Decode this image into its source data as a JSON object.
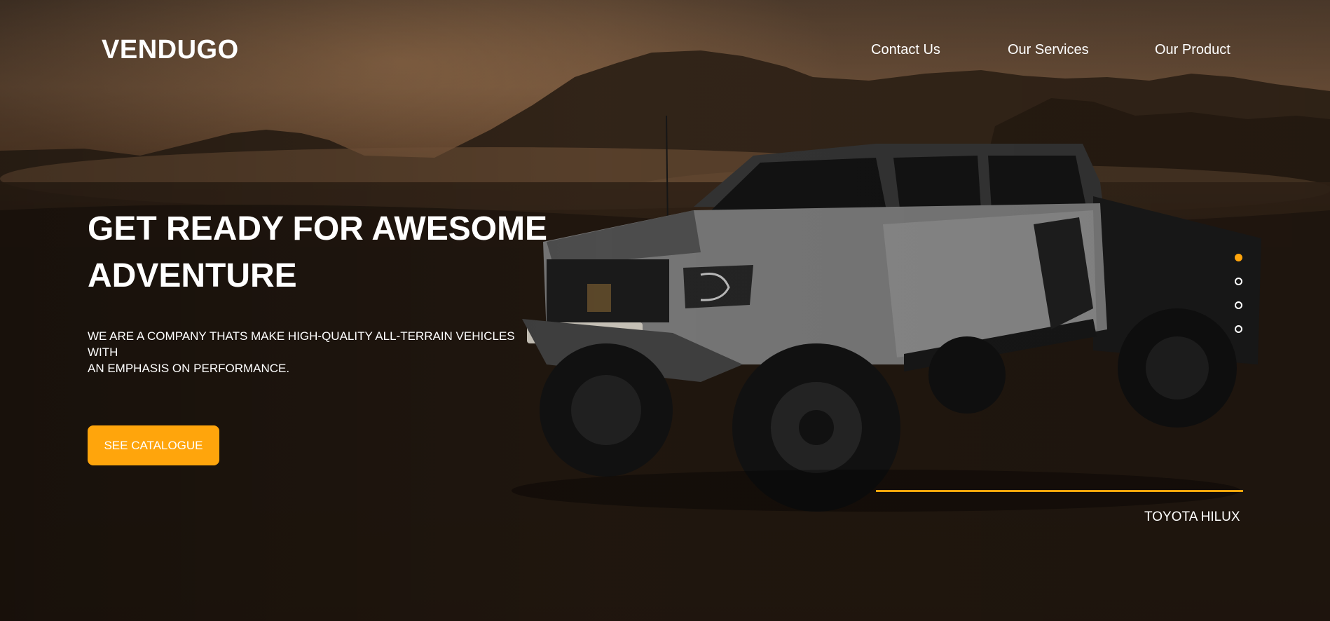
{
  "brand": {
    "name": "VENDUGO"
  },
  "nav": {
    "items": [
      {
        "label": "Contact Us"
      },
      {
        "label": "Our Services"
      },
      {
        "label": "Our Product"
      }
    ]
  },
  "hero": {
    "headline_line1": "GET READY FOR AWESOME",
    "headline_line2": "ADVENTURE",
    "subtext_line1": "WE ARE A COMPANY THATS MAKE HIGH-QUALITY ALL-TERRAIN VEHICLES WITH",
    "subtext_line2": "AN EMPHASIS ON PERFORMANCE.",
    "cta_label": "SEE CATALOGUE"
  },
  "slider": {
    "total_slides": 4,
    "active_index": 0,
    "current_model": "TOYOTA HILUX"
  },
  "background_image": "desert-offroad-truck",
  "colors": {
    "accent": "#ffa50c",
    "text": "#ffffff"
  }
}
